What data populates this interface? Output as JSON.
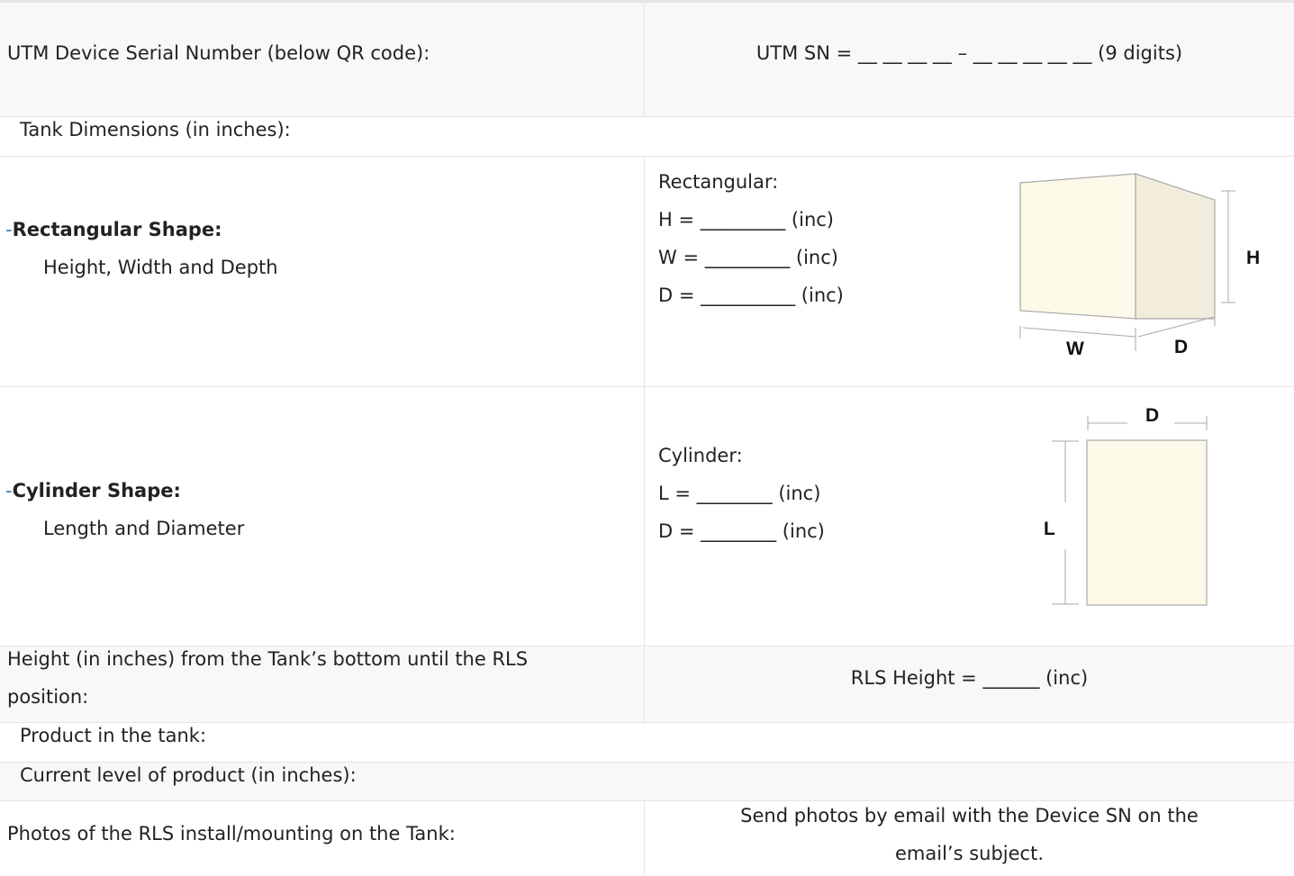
{
  "rows": {
    "serial": {
      "label": "UTM Device Serial Number (below QR code):",
      "value": "UTM SN = __ __ __ __ – __ __ __ __ __ (9 digits)"
    },
    "dimensions": {
      "label": "Tank Dimensions (in inches):"
    },
    "rectangular": {
      "bullet": "-",
      "title": "Rectangular Shape:",
      "subtitle": "Height, Width and Depth",
      "form_title": "Rectangular:",
      "field_h": "H = _________ (inc)",
      "field_w": "W = _________ (inc)",
      "field_d": "D = __________ (inc)",
      "diagram": {
        "label_h": "H",
        "label_w": "W",
        "label_d": "D",
        "fill_front": "#fdf9e8",
        "fill_side": "#f1ecdb"
      }
    },
    "cylinder": {
      "bullet": "-",
      "title": "Cylinder Shape:",
      "subtitle": "Length and Diameter",
      "form_title": "Cylinder:",
      "field_l": "L = ________ (inc)",
      "field_d": "D = ________ (inc)",
      "diagram": {
        "label_d": "D",
        "label_l": "L",
        "fill": "#fdf9e8"
      }
    },
    "rls_height": {
      "label_line1": "Height (in inches) from the Tank’s bottom until the RLS",
      "label_line2": "position:",
      "value": "RLS Height = ______ (inc)"
    },
    "product": {
      "label": "Product in the tank:"
    },
    "current_level": {
      "label": "Current level of product (in inches):"
    },
    "photos": {
      "label": "Photos of the RLS install/mounting on the Tank:",
      "value_line1": "Send photos by email with the Device SN on the",
      "value_line2": "email’s subject."
    }
  },
  "colors": {
    "bullet": "#3b7ac0",
    "row_gray": "#f8f8f8",
    "border": "#e4e4e4"
  }
}
